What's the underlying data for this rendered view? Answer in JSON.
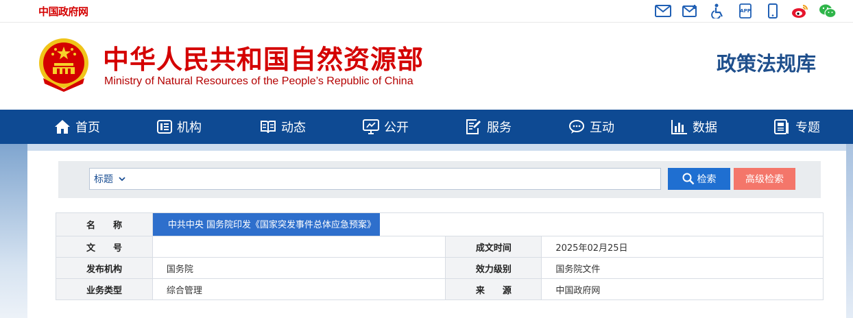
{
  "topbar": {
    "gov_link": "中国政府网",
    "icons": [
      "mail-icon",
      "mail-subscribe-icon",
      "accessibility-icon",
      "app-icon",
      "mobile-icon",
      "weibo-icon",
      "wechat-icon"
    ]
  },
  "header": {
    "ministry_cn": "中华人民共和国自然资源部",
    "ministry_en": "Ministry of Natural Resources of the People’s Republic of China",
    "site_name": "政策法规库"
  },
  "nav": {
    "items": [
      {
        "label": "首页",
        "icon": "home-icon"
      },
      {
        "label": "机构",
        "icon": "organization-icon"
      },
      {
        "label": "动态",
        "icon": "book-icon"
      },
      {
        "label": "公开",
        "icon": "monitor-icon"
      },
      {
        "label": "服务",
        "icon": "edit-doc-icon"
      },
      {
        "label": "互动",
        "icon": "chat-icon"
      },
      {
        "label": "数据",
        "icon": "bar-chart-icon"
      },
      {
        "label": "专题",
        "icon": "topic-icon"
      }
    ]
  },
  "search": {
    "field_selected": "标题",
    "query": "",
    "search_label": "检索",
    "advanced_label": "高级检索"
  },
  "doc": {
    "name_label": "名　　称",
    "name_value": "中共中央 国务院印发《国家突发事件总体应急预案》",
    "docno_label": "文　　号",
    "docno_value": "",
    "date_label": "成文时间",
    "date_value": "2025年02月25日",
    "issuer_label": "发布机构",
    "issuer_value": "国务院",
    "level_label": "效力级别",
    "level_value": "国务院文件",
    "type_label": "业务类型",
    "type_value": "综合管理",
    "source_label": "来　　源",
    "source_value": "中国政府网"
  },
  "colors": {
    "brand_red": "#d40000",
    "nav_blue": "#0e4a93",
    "search_blue": "#1f6fd1",
    "advanced_coral": "#f4766a",
    "highlight_blue": "#2e6fcc"
  }
}
